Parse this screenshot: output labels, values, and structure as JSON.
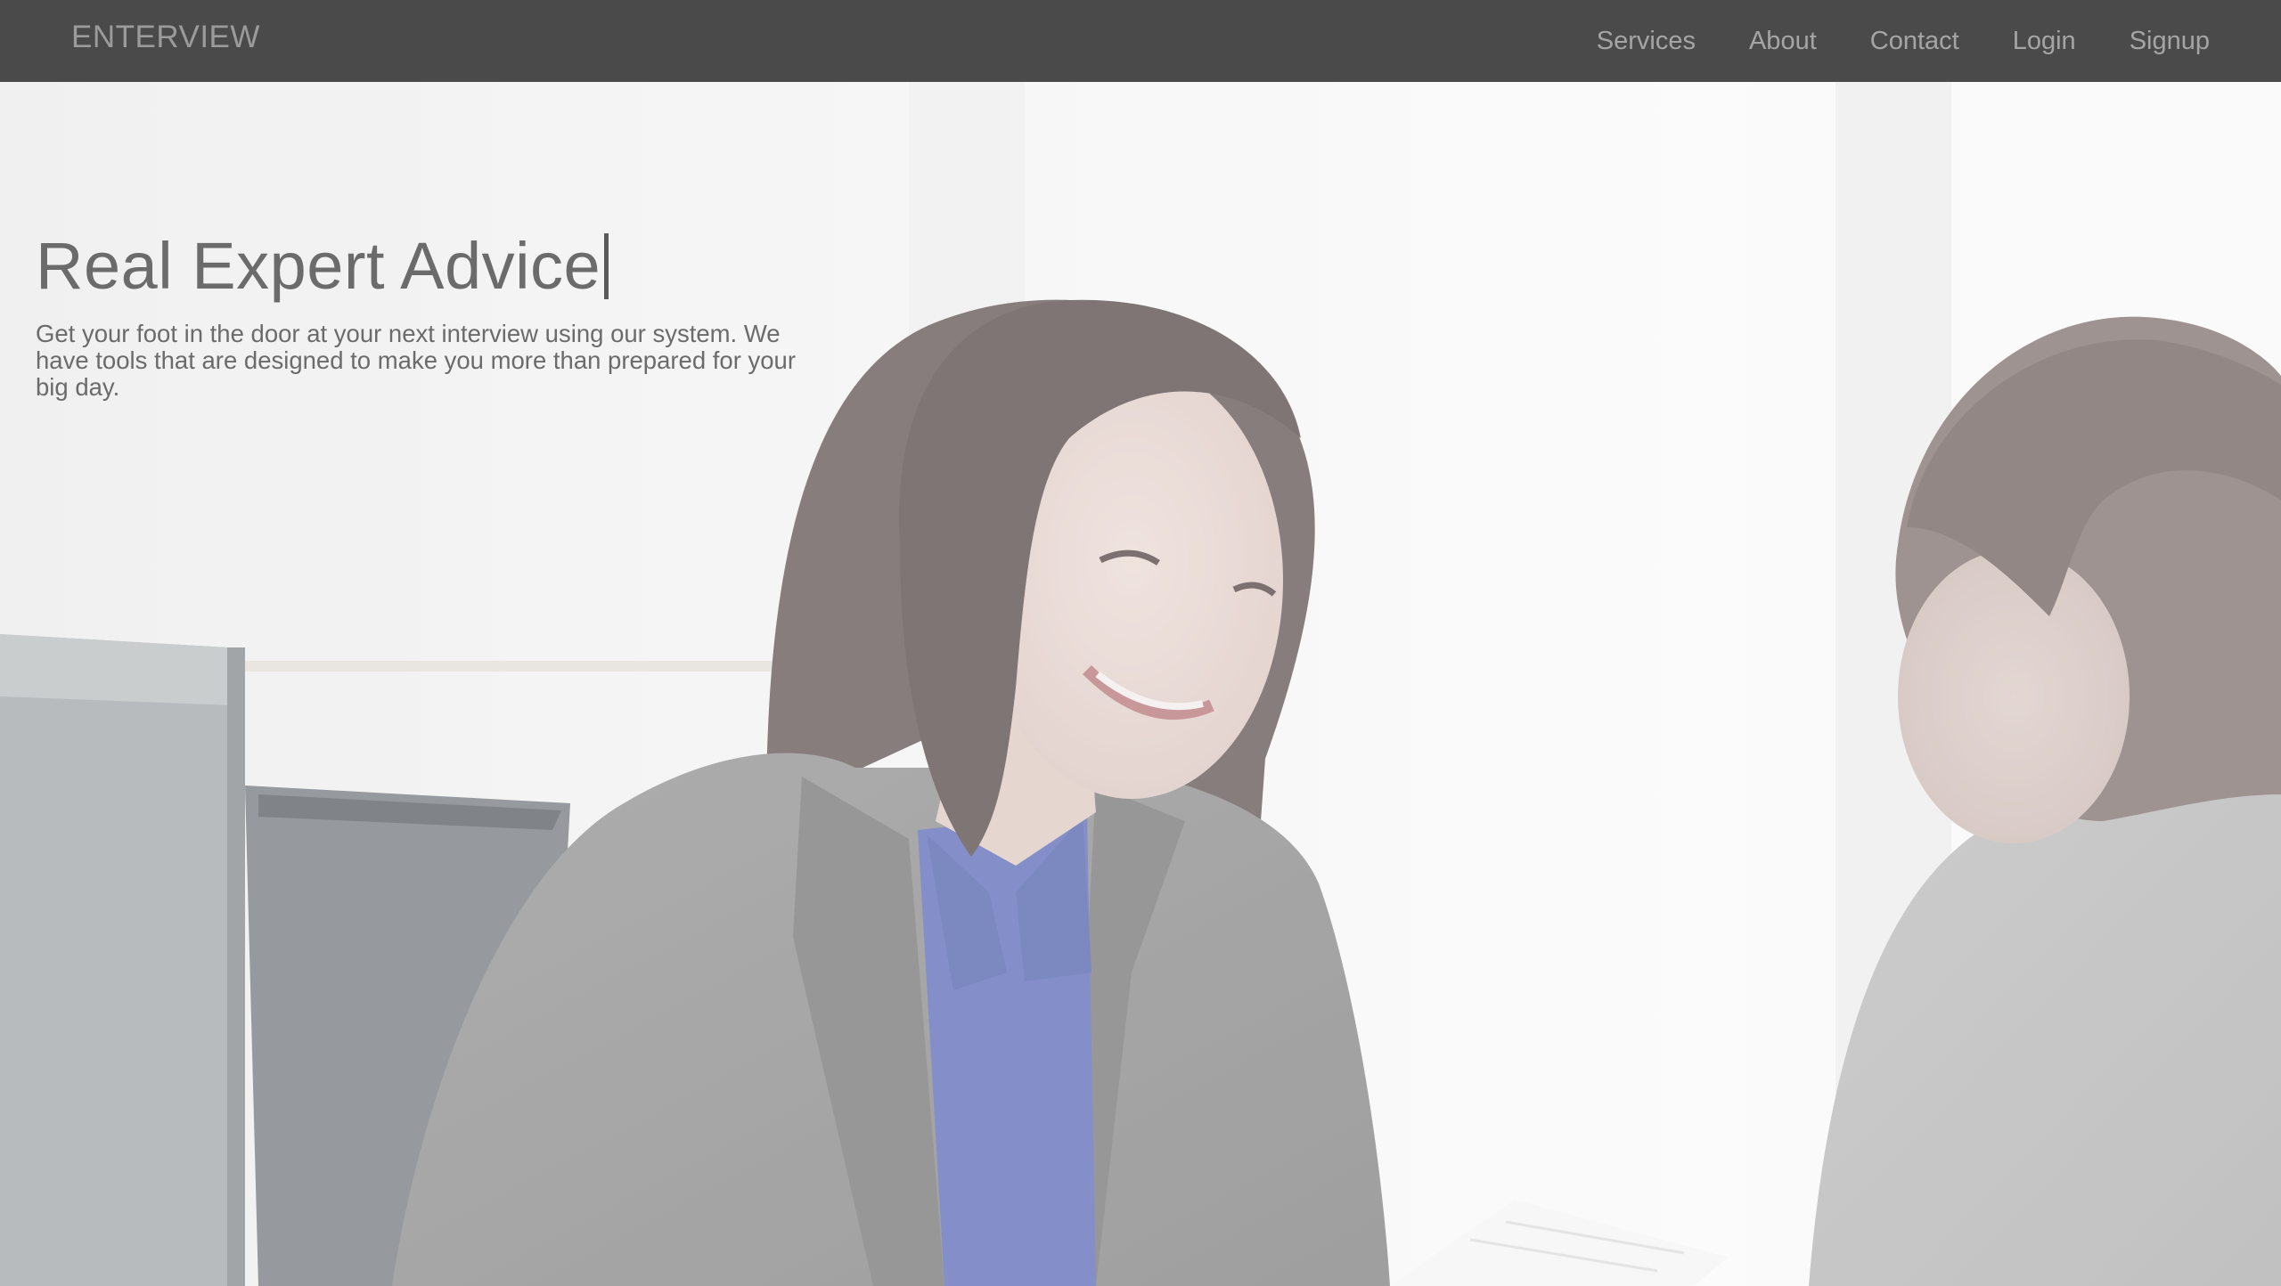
{
  "nav": {
    "brand": "ENTERVIEW",
    "links": [
      "Services",
      "About",
      "Contact",
      "Login",
      "Signup"
    ]
  },
  "hero": {
    "headline": "Real Expert Advice",
    "tagline": "Get your foot in the door at your next interview using our system. We have tools that are designed to make you more than prepared for your big day."
  },
  "colors": {
    "navbar_bg": "#4a4a4a",
    "nav_text": "#a5a5a5",
    "headline_text": "#6b6b6b"
  }
}
